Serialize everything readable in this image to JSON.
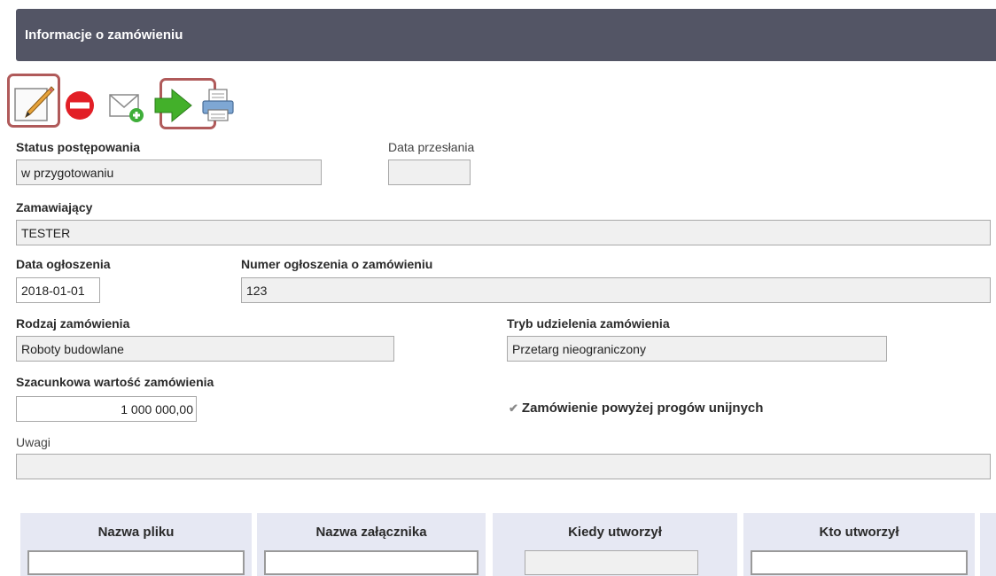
{
  "header": {
    "title": "Informacje o zamówieniu"
  },
  "toolbar": {
    "icons": [
      "pencil-icon",
      "no-entry-icon",
      "mail-add-icon",
      "green-arrow-icon",
      "printer-icon"
    ],
    "highlight_color": "#b05a5a"
  },
  "form": {
    "status_label": "Status postępowania",
    "status_value": "w przygotowaniu",
    "date_sent_label": "Data przesłania",
    "date_sent_value": "",
    "orderer_label": "Zamawiający",
    "orderer_value": "TESTER",
    "announcement_date_label": "Data ogłoszenia",
    "announcement_date_value": "2018-01-01",
    "announcement_number_label": "Numer ogłoszenia o zamówieniu",
    "announcement_number_value": "123",
    "order_type_label": "Rodzaj zamówienia",
    "order_type_value": "Roboty budowlane",
    "procedure_label": "Tryb udzielenia zamówienia",
    "procedure_value": "Przetarg nieograniczony",
    "estimated_value_label": "Szacunkowa wartość zamówienia",
    "estimated_value": "1 000 000,00",
    "eu_threshold_label": "Zamówienie powyżej progów unijnych",
    "eu_threshold_checked": true,
    "notes_label": "Uwagi",
    "notes_value": ""
  },
  "table": {
    "columns": [
      "Nazwa pliku",
      "Nazwa załącznika",
      "Kiedy utworzył",
      "Kto utworzył"
    ]
  },
  "colors": {
    "header_bg": "#535565",
    "table_header_bg": "#e6e8f3"
  }
}
